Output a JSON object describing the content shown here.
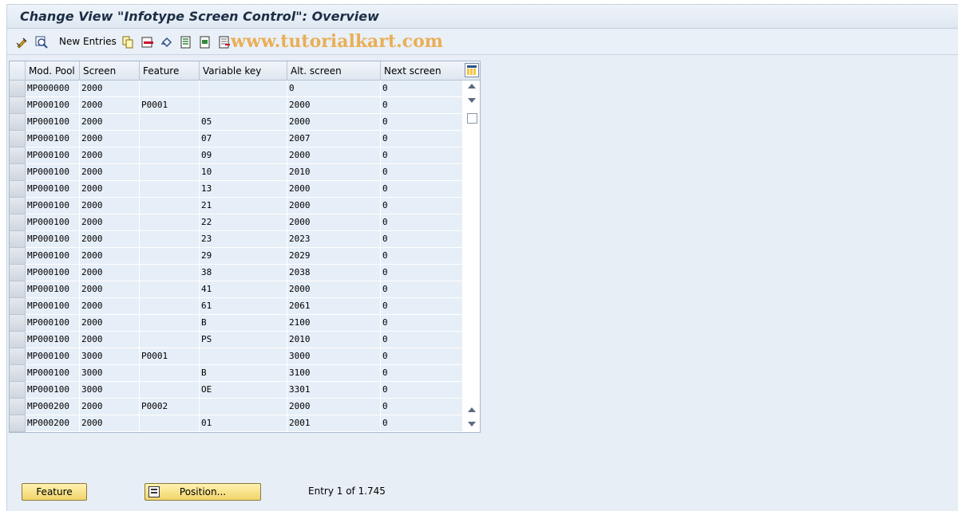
{
  "window": {
    "title": "Change View \"Infotype Screen Control\": Overview"
  },
  "toolbar": {
    "new_entries_label": "New Entries",
    "watermark": "www.tutorialkart.com",
    "icons": [
      "display-change-icon",
      "details-icon",
      "copy-icon",
      "delete-icon",
      "undo-icon",
      "select-all-icon",
      "select-block-icon",
      "deselect-all-icon"
    ]
  },
  "table": {
    "columns": [
      "Mod. Pool",
      "Screen",
      "Feature",
      "Variable key",
      "Alt. screen",
      "Next screen"
    ],
    "rows": [
      [
        "MP000000",
        "2000",
        "",
        "",
        "0",
        "0"
      ],
      [
        "MP000100",
        "2000",
        "P0001",
        "",
        "2000",
        "0"
      ],
      [
        "MP000100",
        "2000",
        "",
        "05",
        "2000",
        "0"
      ],
      [
        "MP000100",
        "2000",
        "",
        "07",
        "2007",
        "0"
      ],
      [
        "MP000100",
        "2000",
        "",
        "09",
        "2000",
        "0"
      ],
      [
        "MP000100",
        "2000",
        "",
        "10",
        "2010",
        "0"
      ],
      [
        "MP000100",
        "2000",
        "",
        "13",
        "2000",
        "0"
      ],
      [
        "MP000100",
        "2000",
        "",
        "21",
        "2000",
        "0"
      ],
      [
        "MP000100",
        "2000",
        "",
        "22",
        "2000",
        "0"
      ],
      [
        "MP000100",
        "2000",
        "",
        "23",
        "2023",
        "0"
      ],
      [
        "MP000100",
        "2000",
        "",
        "29",
        "2029",
        "0"
      ],
      [
        "MP000100",
        "2000",
        "",
        "38",
        "2038",
        "0"
      ],
      [
        "MP000100",
        "2000",
        "",
        "41",
        "2000",
        "0"
      ],
      [
        "MP000100",
        "2000",
        "",
        "61",
        "2061",
        "0"
      ],
      [
        "MP000100",
        "2000",
        "",
        "B",
        "2100",
        "0"
      ],
      [
        "MP000100",
        "2000",
        "",
        "PS",
        "2010",
        "0"
      ],
      [
        "MP000100",
        "3000",
        "P0001",
        "",
        "3000",
        "0"
      ],
      [
        "MP000100",
        "3000",
        "",
        "B",
        "3100",
        "0"
      ],
      [
        "MP000100",
        "3000",
        "",
        "OE",
        "3301",
        "0"
      ],
      [
        "MP000200",
        "2000",
        "P0002",
        "",
        "2000",
        "0"
      ],
      [
        "MP000200",
        "2000",
        "",
        "01",
        "2001",
        "0"
      ]
    ]
  },
  "footer": {
    "feature_button": "Feature",
    "position_button": "Position...",
    "entry_status": "Entry 1 of 1.745"
  }
}
